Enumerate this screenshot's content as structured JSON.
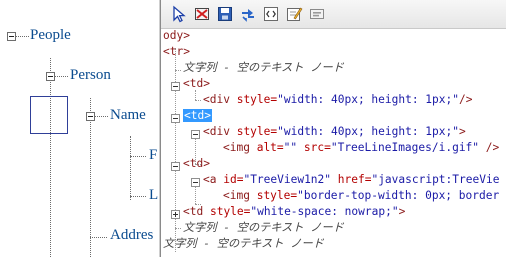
{
  "tree": {
    "people_label": "People",
    "person_label": "Person",
    "name_label": "Name",
    "address_label": "Addres",
    "clipped_label_1": "F",
    "clipped_label_2": "L"
  },
  "devtools": {
    "toolbar_icons": [
      "select-element-icon",
      "clear-icon",
      "save-icon",
      "refresh-icon",
      "view-source-icon",
      "edit-icon",
      "layout-icon"
    ],
    "lines": {
      "l1": "ody>",
      "l2": "<tr>",
      "l3": "文字列 - 空のテキスト ノード",
      "l4": "<td>",
      "l5_tag": "<div",
      "l5_attr": "style=",
      "l5_val": "\"width: 40px; height: 1px;\"",
      "l5_end": "/>",
      "l6": "<td>",
      "l7_tag": "<div",
      "l7_attr": "style=",
      "l7_val": "\"width: 40px; height: 1px;\"",
      "l7_end": ">",
      "l8_tag": "<img",
      "l8_attr1": "alt=",
      "l8_val1": "\"\"",
      "l8_attr2": "src=",
      "l8_val2": "\"TreeLineImages/i.gif\"",
      "l8_end": "/>",
      "l9": "<td>",
      "l10_tag": "<a",
      "l10_attr1": "id=",
      "l10_val1": "\"TreeView1n2\"",
      "l10_attr2": "href=",
      "l10_val2": "\"javascript:TreeVie",
      "l11_tag": "<img",
      "l11_attr": "style=",
      "l11_val": "\"border-top-width: 0px; border",
      "l12_tag": "<td",
      "l12_attr": "style=",
      "l12_val": "\"white-space: nowrap;\"",
      "l12_end": ">",
      "l13": "文字列 - 空のテキスト ノード",
      "l14": "文字列 - 空のテキスト ノード"
    }
  }
}
